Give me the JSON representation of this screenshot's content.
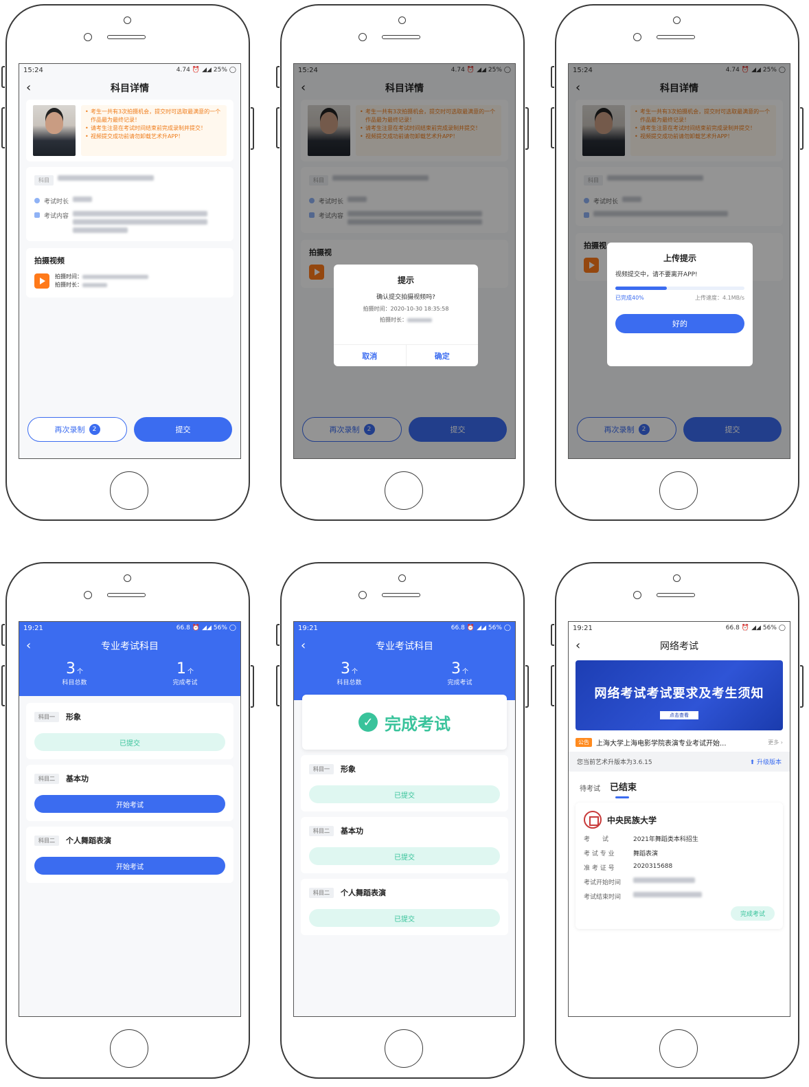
{
  "colors": {
    "primary": "#3b6cf0",
    "accent_orange": "#ef7c1a",
    "success": "#39c39b"
  },
  "screen1": {
    "time": "15:24",
    "net": "4.74",
    "battery": "25%",
    "title": "科目详情",
    "notices": [
      "考生一共有3次拍摄机会，提交时可选取最满意的一个作品最为最终记录！",
      "请考生注意在考试时间结束前完成录制并提交！",
      "视频提交成功前请勿卸载艺术升APP！"
    ],
    "subject_label": "科目",
    "exam_duration_label": "考试时长",
    "exam_content_label": "考试内容",
    "video_section": "拍摄视频",
    "shoot_time_label": "拍摄时间：",
    "shoot_duration_label": "拍摄时长：",
    "rerecord": "再次录制",
    "rerecord_count": "2",
    "submit": "提交"
  },
  "screen2": {
    "dialog_title": "提示",
    "dialog_msg": "确认提交拍摄视频吗?",
    "dialog_time": "拍摄时间：2020-10-30 18:35:58",
    "dialog_duration": "拍摄时长：",
    "cancel": "取消",
    "confirm": "确定",
    "section_partial": "拍摄视"
  },
  "screen3": {
    "dialog_title": "上传提示",
    "dialog_msg": "视频提交中，请不要离开APP!",
    "progress_label": "已完成40%",
    "progress": 0.4,
    "speed": "上传速度：4.1MB/s",
    "ok": "好的",
    "section_partial": "拍摄视"
  },
  "screen4": {
    "time": "19:21",
    "net": "66.8",
    "battery": "56%",
    "title": "专业考试科目",
    "total_num": "3",
    "total_unit": "个",
    "total_label": "科目总数",
    "done_num": "1",
    "done_unit": "个",
    "done_label": "完成考试",
    "subjects": [
      {
        "tag": "科目一",
        "name": "形象",
        "action": "已提交"
      },
      {
        "tag": "科目二",
        "name": "基本功",
        "action": "开始考试"
      },
      {
        "tag": "科目二",
        "name": "个人舞蹈表演",
        "action": "开始考试"
      }
    ]
  },
  "screen5": {
    "title": "专业考试科目",
    "total_num": "3",
    "done_num": "3",
    "complete_text": "完成考试",
    "subjects": [
      {
        "tag": "科目一",
        "name": "形象",
        "action": "已提交"
      },
      {
        "tag": "科目二",
        "name": "基本功",
        "action": "已提交"
      },
      {
        "tag": "科目二",
        "name": "个人舞蹈表演",
        "action": "已提交"
      }
    ]
  },
  "screen6": {
    "title": "网络考试",
    "banner_title": "网络考试考试要求及考生须知",
    "banner_button": "点击查看",
    "announce_tag": "公告",
    "announce_text": "上海大学上海电影学院表演专业考试开始...",
    "announce_more": "更多",
    "version_text": "您当前艺术升版本为3.6.15",
    "upgrade": "升级版本",
    "tab_pending": "待考试",
    "tab_ended": "已结束",
    "school": "中央民族大学",
    "exam_label": "考　　试",
    "exam_value": "2021年舞蹈类本科招生",
    "major_label": "考 试 专 业",
    "major_value": "舞蹈表演",
    "ticket_label": "准 考 证 号",
    "ticket_value": "2020315688",
    "start_label": "考试开始时间",
    "end_label": "考试结束时间",
    "status": "完成考试"
  }
}
